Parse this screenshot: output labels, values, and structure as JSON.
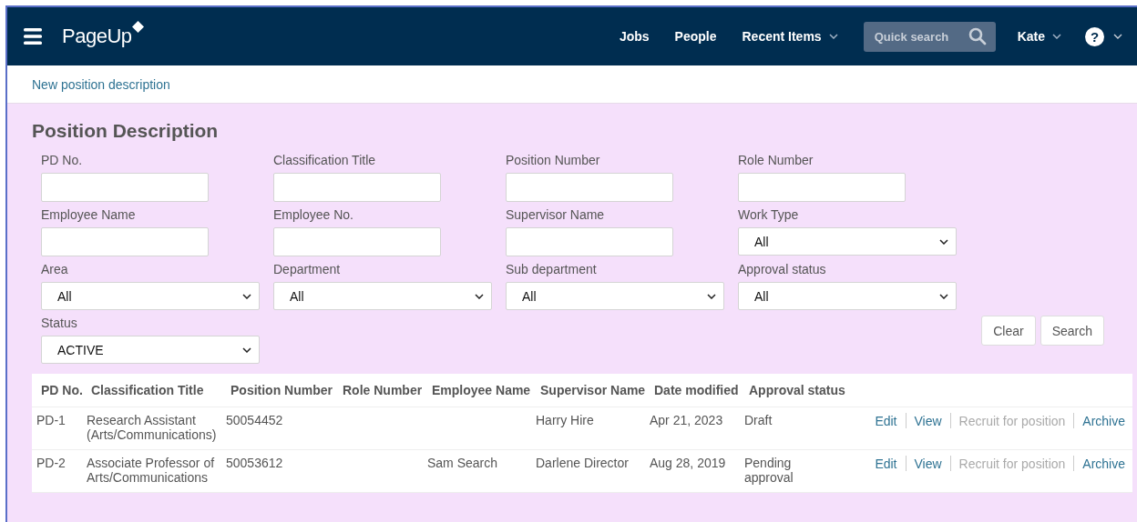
{
  "nav": {
    "logo": "PageUp",
    "items": [
      {
        "label": "Jobs",
        "dropdown": false
      },
      {
        "label": "People",
        "dropdown": false
      },
      {
        "label": "Recent Items",
        "dropdown": true
      }
    ],
    "search": {
      "placeholder": "Quick search"
    },
    "user": "Kate",
    "help": "?"
  },
  "subbar": {
    "link": "New position description"
  },
  "page": {
    "title": "Position Description"
  },
  "filters": [
    {
      "label": "PD No.",
      "kind": "text"
    },
    {
      "label": "Classification Title",
      "kind": "text"
    },
    {
      "label": "Position Number",
      "kind": "text"
    },
    {
      "label": "Role Number",
      "kind": "text"
    },
    {
      "label": "Employee Name",
      "kind": "text"
    },
    {
      "label": "Employee No.",
      "kind": "text"
    },
    {
      "label": "Supervisor Name",
      "kind": "text"
    },
    {
      "label": "Work Type",
      "kind": "select",
      "value": "All"
    },
    {
      "label": "Area",
      "kind": "select",
      "value": "All"
    },
    {
      "label": "Department",
      "kind": "select",
      "value": "All"
    },
    {
      "label": "Sub department",
      "kind": "select",
      "value": "All"
    },
    {
      "label": "Approval status",
      "kind": "select",
      "value": "All"
    },
    {
      "label": "Status",
      "kind": "select",
      "value": "ACTIVE"
    }
  ],
  "buttons": [
    "Clear",
    "Search"
  ],
  "table": {
    "columns": [
      "PD No.",
      "Classification Title",
      "Position Number",
      "Role Number",
      "Employee Name",
      "Supervisor Name",
      "Date modified",
      "Approval status"
    ],
    "rows": [
      {
        "cells": [
          "PD-1",
          "Research Assistant (Arts/Communications)",
          "50054452",
          "",
          "",
          "Harry Hire",
          "Apr 21, 2023",
          "Draft"
        ],
        "actions": [
          {
            "label": "Edit",
            "disabled": false
          },
          {
            "label": "View",
            "disabled": false
          },
          {
            "label": "Recruit for position",
            "disabled": true
          },
          {
            "label": "Archive",
            "disabled": false
          }
        ]
      },
      {
        "cells": [
          "PD-2",
          "Associate Professor of Arts/Communications",
          "50053612",
          "",
          "Sam Search",
          "Darlene Director",
          "Aug 28, 2019",
          "Pending approval"
        ],
        "actions": [
          {
            "label": "Edit",
            "disabled": false
          },
          {
            "label": "View",
            "disabled": false
          },
          {
            "label": "Recruit for position",
            "disabled": true
          },
          {
            "label": "Archive",
            "disabled": false
          }
        ]
      }
    ]
  }
}
